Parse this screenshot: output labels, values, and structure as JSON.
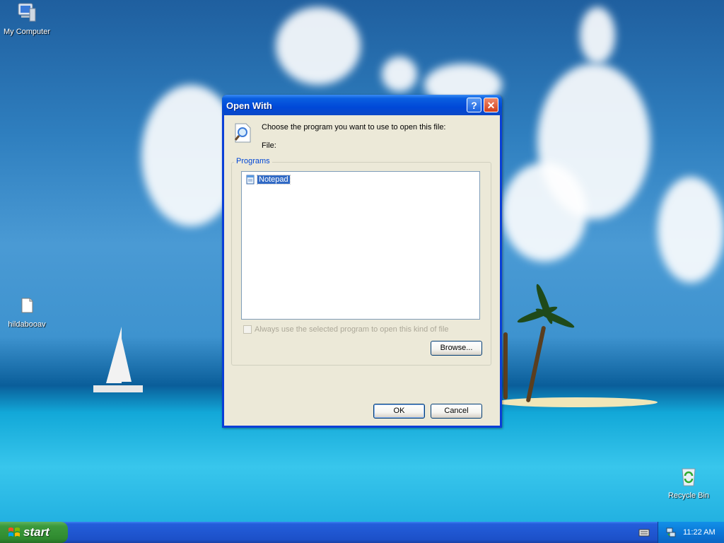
{
  "desktop": {
    "icons": [
      {
        "label": "My Computer",
        "icon": "my-computer-icon"
      },
      {
        "label": "hildabooav",
        "icon": "folder-icon"
      },
      {
        "label": "Recycle Bin",
        "icon": "recycle-bin-icon"
      }
    ]
  },
  "dialog": {
    "title": "Open With",
    "help_button": "?",
    "close_button": "✕",
    "prompt": "Choose the program you want to use to open this file:",
    "file_label": "File:",
    "programs_group": "Programs",
    "programs": [
      {
        "name": "Notepad",
        "selected": true
      }
    ],
    "always_use_label": "Always use the selected program to open this kind of file",
    "always_use_checked": false,
    "always_use_enabled": false,
    "browse_label": "Browse...",
    "ok_label": "OK",
    "cancel_label": "Cancel"
  },
  "taskbar": {
    "start_label": "start",
    "clock": "11:22 AM"
  },
  "colors": {
    "title_bar": "#0048d8",
    "selection": "#316ac5",
    "start_green": "#3c9a3c",
    "group_label": "#0046d5"
  }
}
